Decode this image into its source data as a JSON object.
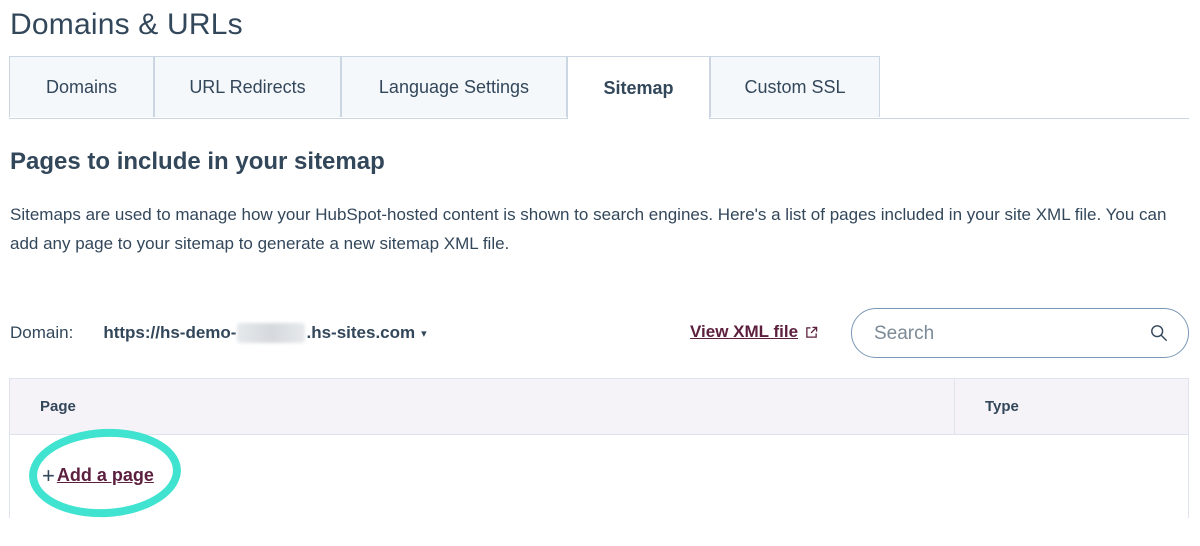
{
  "header": {
    "title": "Domains & URLs"
  },
  "tabs": [
    {
      "label": "Domains",
      "active": false
    },
    {
      "label": "URL Redirects",
      "active": false
    },
    {
      "label": "Language Settings",
      "active": false
    },
    {
      "label": "Sitemap",
      "active": true
    },
    {
      "label": "Custom SSL",
      "active": false
    }
  ],
  "section": {
    "title": "Pages to include in your sitemap",
    "description": "Sitemaps are used to manage how your HubSpot-hosted content is shown to search engines. Here's a list of pages included in your site XML file. You can add any page to your sitemap to generate a new sitemap XML file."
  },
  "domain": {
    "label": "Domain:",
    "url_prefix": "https://hs-demo-",
    "url_suffix": ".hs-sites.com",
    "caret": "▾"
  },
  "view_xml": {
    "label": "View XML file",
    "icon": "external-link-icon"
  },
  "search": {
    "placeholder": "Search",
    "value": "",
    "icon": "search-icon"
  },
  "table": {
    "columns": [
      "Page",
      "Type"
    ],
    "add_page": {
      "icon": "+",
      "label": "Add a page"
    }
  },
  "colors": {
    "text": "#33475b",
    "link": "#5c1f3e",
    "highlight": "#3fe3cf",
    "table_header_bg": "#f6f3f8"
  }
}
